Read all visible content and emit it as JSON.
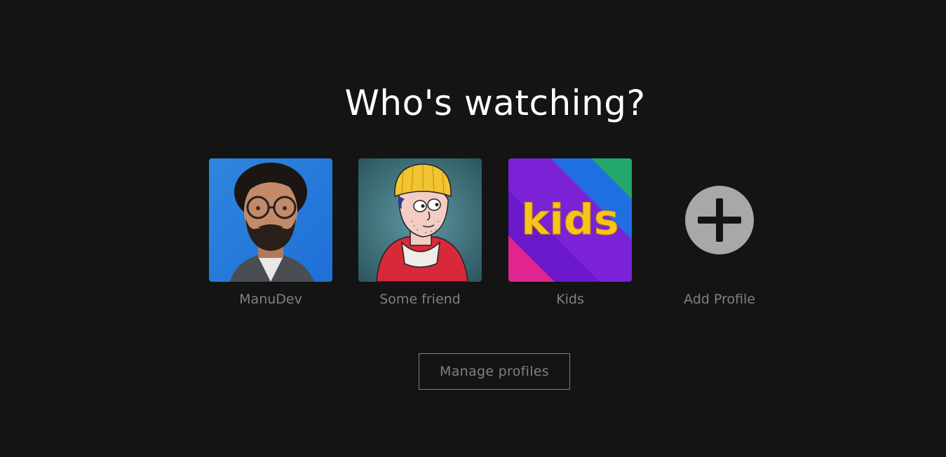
{
  "heading": "Who's watching?",
  "profiles": [
    {
      "name": "ManuDev",
      "avatar_icon": "man-glasses-portrait"
    },
    {
      "name": "Some friend",
      "avatar_icon": "cartoon-beanie-character"
    },
    {
      "name": "Kids",
      "avatar_icon": "kids-logo",
      "avatar_text": "kids"
    },
    {
      "name": "Add Profile",
      "avatar_icon": "plus-circle-icon"
    }
  ],
  "manage_button": "Manage profiles",
  "colors": {
    "background": "#141414",
    "heading": "#ffffff",
    "muted_text": "#808080",
    "add_icon": "#a8a8a8"
  }
}
